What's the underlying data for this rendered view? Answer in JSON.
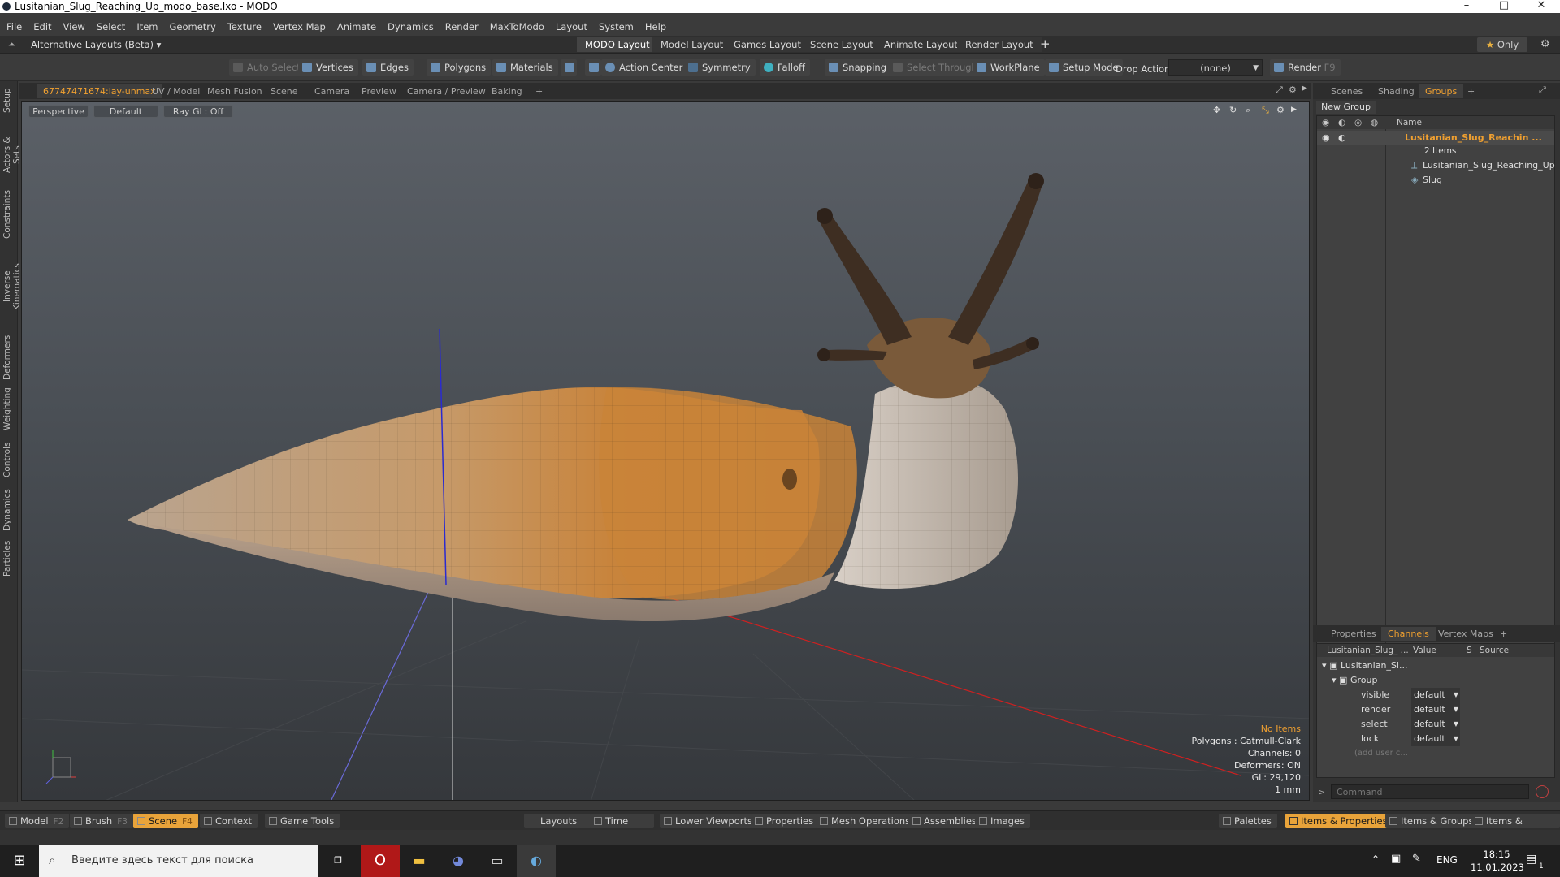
{
  "window": {
    "title": "Lusitanian_Slug_Reaching_Up_modo_base.lxo - MODO",
    "minimize": "–",
    "maximize": "□",
    "close": "✕"
  },
  "menu": [
    "File",
    "Edit",
    "View",
    "Select",
    "Item",
    "Geometry",
    "Texture",
    "Vertex Map",
    "Animate",
    "Dynamics",
    "Render",
    "MaxToModo",
    "Layout",
    "System",
    "Help"
  ],
  "layoutbar": {
    "alt_layouts": "Alternative Layouts (Beta)",
    "tabs": [
      "MODO Layout",
      "Model Layout",
      "Games Layout",
      "Scene Layout",
      "Animate Layout",
      "Render Layout"
    ],
    "add": "+",
    "only": "Only",
    "star": "★"
  },
  "toolbar": {
    "auto_select": "Auto Select",
    "vertices": "Vertices",
    "edges": "Edges",
    "polygons": "Polygons",
    "materials": "Materials",
    "action_center": "Action Center",
    "symmetry": "Symmetry",
    "falloff": "Falloff",
    "snapping": "Snapping",
    "select_through": "Select Through",
    "workplane": "WorkPlane",
    "setup_mode": "Setup Mode",
    "drop_action": "Drop Action",
    "drop_value": "(none)",
    "render": "Render",
    "render_key": "F9"
  },
  "left_tabs": [
    "Setup",
    "Actors & Sets",
    "Constraints",
    "Inverse Kinematics",
    "Deformers",
    "Weighting",
    "Controls",
    "Dynamics",
    "Particles"
  ],
  "viewport_tabs": [
    "67747471674:lay-unmax",
    "UV / Model",
    "Mesh Fusion",
    "Scene",
    "Camera",
    "Preview",
    "Camera / Preview",
    "Baking",
    "+"
  ],
  "viewport": {
    "view": "Perspective",
    "shading": "Default",
    "raygl": "Ray GL: Off",
    "info": [
      "No Items",
      "Polygons : Catmull-Clark",
      "Channels: 0",
      "Deformers: ON",
      "GL: 29,120",
      "1 mm"
    ]
  },
  "scene_panel": {
    "tabs": [
      "Scenes",
      "Shading",
      "Groups",
      "+"
    ],
    "new_group": "New Group",
    "col_name": "Name",
    "group_name": "Lusitanian_Slug_Reachin ...",
    "group_count": "2 Items",
    "items": [
      "Lusitanian_Slug_Reaching_Up",
      "Slug"
    ]
  },
  "channels_panel": {
    "tabs": [
      "Properties",
      "Channels",
      "Vertex Maps",
      "+"
    ],
    "col_item": "Lusitanian_Slug_ ...",
    "col_value": "Value",
    "col_s": "S",
    "col_source": "Source",
    "root": "Lusitanian_Sl...",
    "group": "Group",
    "channels": [
      {
        "name": "visible",
        "value": "default"
      },
      {
        "name": "render",
        "value": "default"
      },
      {
        "name": "select",
        "value": "default"
      },
      {
        "name": "lock",
        "value": "default"
      }
    ],
    "add_user": "(add user c...",
    "command_placeholder": "Command"
  },
  "bottombar": {
    "model": "Model",
    "model_key": "F2",
    "brush": "Brush",
    "brush_key": "F3",
    "scene": "Scene",
    "scene_key": "F4",
    "context": "Context",
    "game_tools": "Game Tools",
    "layouts": "Layouts",
    "time": "Time",
    "lower_viewports": "Lower Viewports",
    "properties": "Properties",
    "mesh_operations": "Mesh Operations",
    "assemblies": "Assemblies",
    "images": "Images",
    "palettes": "Palettes",
    "items_properties": "Items & Properties",
    "items_groups": "Items & Groups",
    "items_shading": "Items & Shading"
  },
  "taskbar": {
    "search_placeholder": "Введите здесь текст для поиска",
    "lang": "ENG",
    "time": "18:15",
    "date": "11.01.2023",
    "notif": "1"
  },
  "colors": {
    "accent": "#f0a030",
    "active_tab": "#e8a33a",
    "axis_x": "#d02020",
    "axis_y": "#3030d0"
  }
}
